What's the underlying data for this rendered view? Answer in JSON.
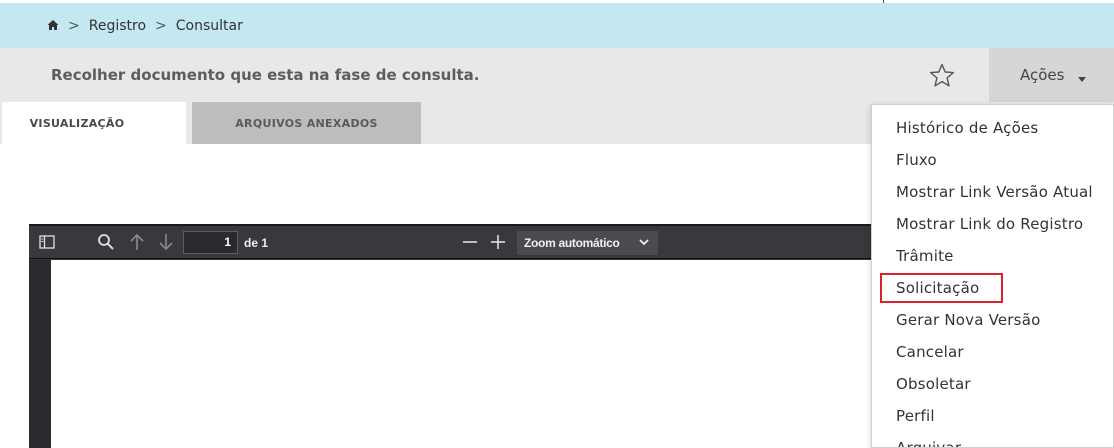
{
  "breadcrumb": {
    "home_icon": "home-icon",
    "separator": ">",
    "items": [
      "Registro",
      "Consultar"
    ]
  },
  "header": {
    "title": "Recolher documento que esta na fase de consulta.",
    "favorite_icon": "star-outline-icon",
    "actions_label": "Ações"
  },
  "tabs": [
    {
      "label": "VISUALIZAÇÃO",
      "active": true
    },
    {
      "label": "ARQUIVOS ANEXADOS",
      "active": false
    }
  ],
  "pdf_viewer": {
    "page_number": "1",
    "page_count": "de 1",
    "zoom": "Zoom automático"
  },
  "actions_menu": {
    "items": [
      "Histórico de Ações",
      "Fluxo",
      "Mostrar Link Versão Atual",
      "Mostrar Link do Registro",
      "Trâmite",
      "Solicitação",
      "Gerar Nova Versão",
      "Cancelar",
      "Obsoletar",
      "Perfil",
      "Arquivar"
    ],
    "highlighted": "Solicitação"
  },
  "colors": {
    "breadcrumb_bg": "#c3e8f1",
    "header_bg": "#e8e8e8",
    "pdf_toolbar_bg": "#38383d",
    "highlight_border": "#d9232d"
  }
}
